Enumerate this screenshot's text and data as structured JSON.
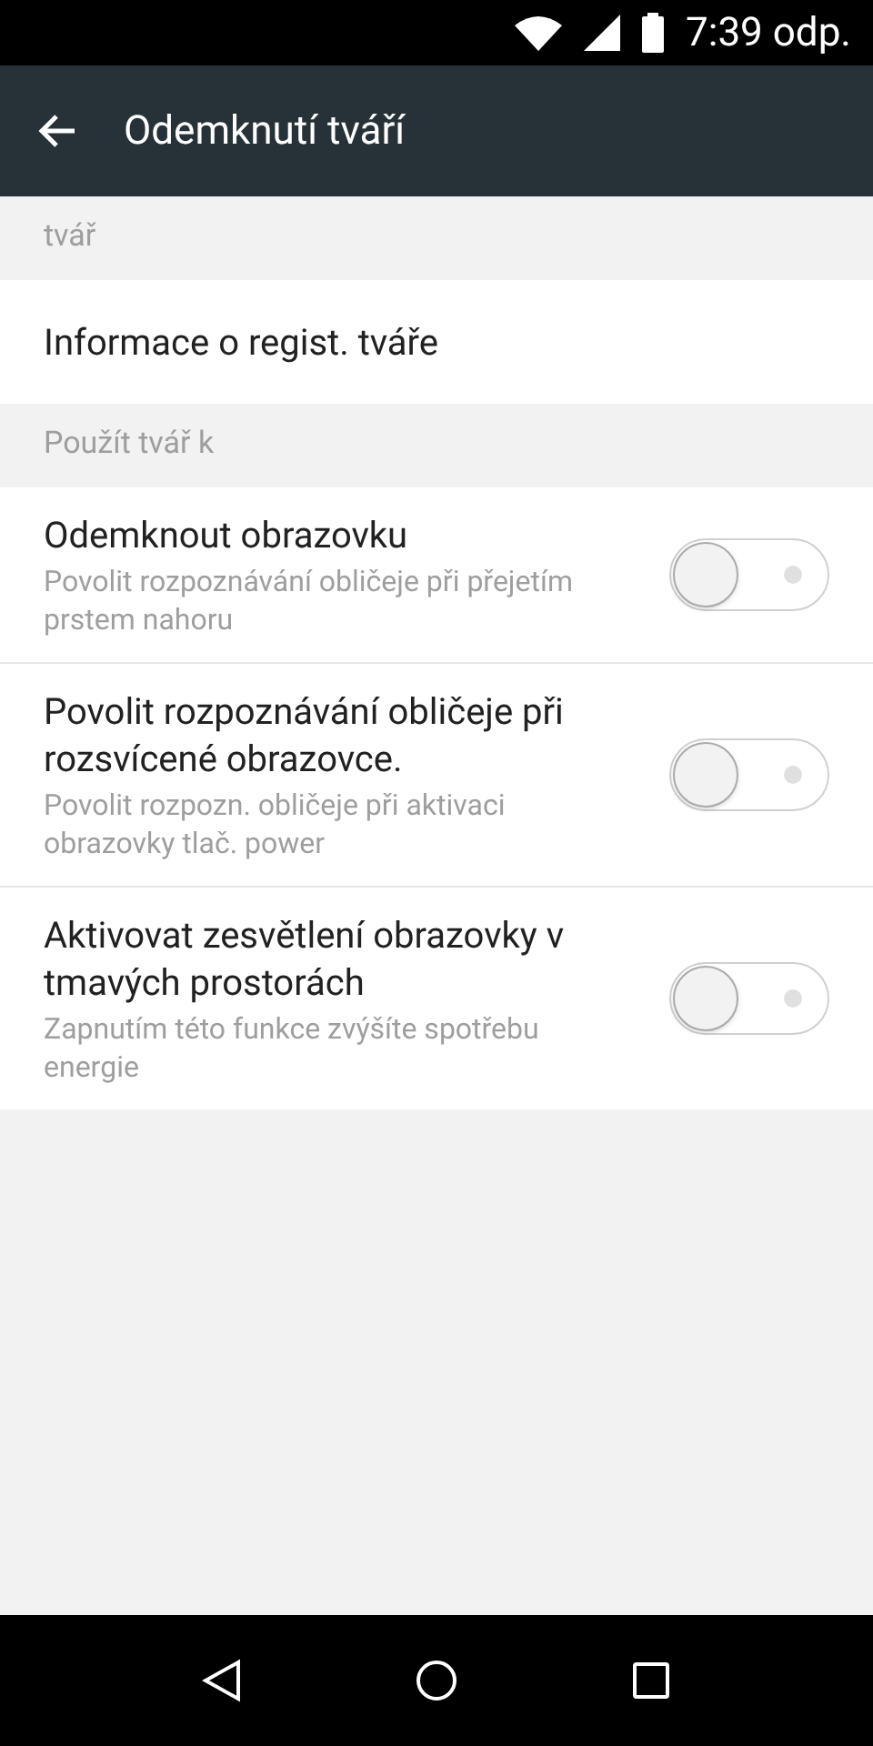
{
  "status_bar": {
    "time": "7:39 odp."
  },
  "app_bar": {
    "title": "Odemknutí tváří"
  },
  "sections": [
    {
      "header": "tvář",
      "items": [
        {
          "kind": "link",
          "title": "Informace o regist. tváře"
        }
      ]
    },
    {
      "header": "Použít tvář k",
      "items": [
        {
          "kind": "switch",
          "title": "Odemknout obrazovku",
          "summary": "Povolit rozpoznávání obličeje při přejetím prstem nahoru",
          "on": false
        },
        {
          "kind": "switch",
          "title": "Povolit rozpoznávání obličeje při rozsvícené obrazovce.",
          "summary": "Povolit rozpozn. obličeje při aktivaci obrazovky tlač. power",
          "on": false
        },
        {
          "kind": "switch",
          "title": "Aktivovat zesvětlení obrazovky v tmavých prostorách",
          "summary": "Zapnutím této funkce zvýšíte spotřebu energie",
          "on": false
        }
      ]
    }
  ]
}
